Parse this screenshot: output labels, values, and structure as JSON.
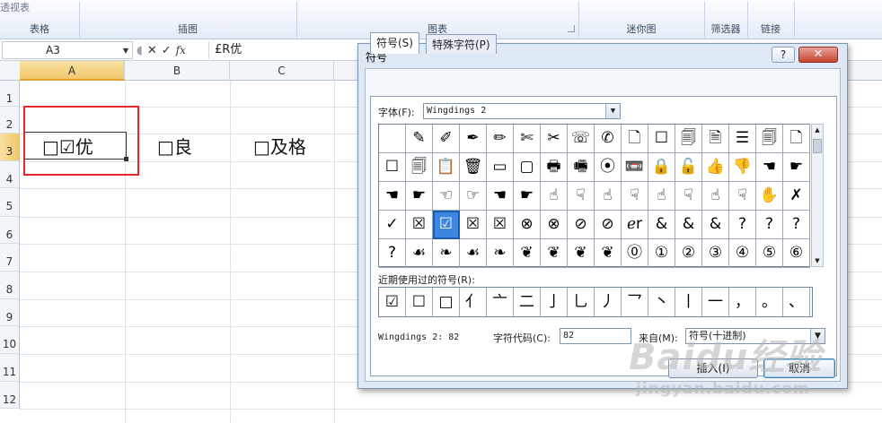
{
  "ribbon": {
    "cut_label": "透视表",
    "groups": [
      "表格",
      "插图",
      "图表",
      "迷你图",
      "筛选器",
      "链接"
    ]
  },
  "formula_bar": {
    "name_box": "A3",
    "content": "£R优"
  },
  "sheet": {
    "columns": [
      "A",
      "B",
      "C"
    ],
    "rows": [
      "1",
      "2",
      "3",
      "4",
      "5",
      "6",
      "7",
      "8",
      "9",
      "10",
      "11",
      "12"
    ],
    "cells": {
      "a3": "□☑优",
      "b3": "□良",
      "c3": "□及格"
    }
  },
  "dialog": {
    "title": "符号",
    "help_label": "?",
    "close_label": "✕",
    "tabs": [
      "符号(S)",
      "特殊字符(P)"
    ],
    "font_label": "字体(F):",
    "font_value": "Wingdings 2",
    "symbols": [
      "",
      "✎",
      "✐",
      "✒",
      "✏",
      "✄",
      "✂",
      "☏",
      "✆",
      "🗋",
      "☐",
      "🗐",
      "🗎",
      "☰",
      "🗐",
      "🗋",
      "☐",
      "🗐",
      "📋",
      "🗑",
      "▭",
      "▢",
      "🖶",
      "🖷",
      "⦿",
      "📼",
      "🔒",
      "🔓",
      "👍",
      "👎",
      "☚",
      "☛",
      "☚",
      "☛",
      "☜",
      "☞",
      "☚",
      "☛",
      "☝",
      "☟",
      "☝",
      "☟",
      "☝",
      "☟",
      "☝",
      "☟",
      "✋",
      "✗",
      "✓",
      "☒",
      "☑",
      "☒",
      "☒",
      "⊗",
      "⊗",
      "⊘",
      "⊘",
      "ℯr",
      "&",
      "&",
      "&",
      "?",
      "?",
      "?",
      "?",
      "☙",
      "❧",
      "☙",
      "❧",
      "❦",
      "❦",
      "❦",
      "❦",
      "⓪",
      "①",
      "②",
      "③",
      "④",
      "⑤",
      "⑥"
    ],
    "recent_label": "近期使用过的符号(R):",
    "recent": [
      "☑",
      "☐",
      "□",
      "亻",
      "亠",
      "二",
      "亅",
      "乚",
      "丿",
      "乛",
      "丶",
      "丨",
      "一",
      "，",
      "。",
      "、"
    ],
    "code_name": "Wingdings 2: 82",
    "code_label": "字符代码(C):",
    "code_value": "82",
    "from_label": "来自(M):",
    "from_value": "符号(十进制)",
    "buttons": {
      "insert": "插入(I)",
      "cancel": "取消"
    }
  },
  "watermark": {
    "line1": "Baidu经验",
    "line2": "jingyan.baidu.com"
  }
}
